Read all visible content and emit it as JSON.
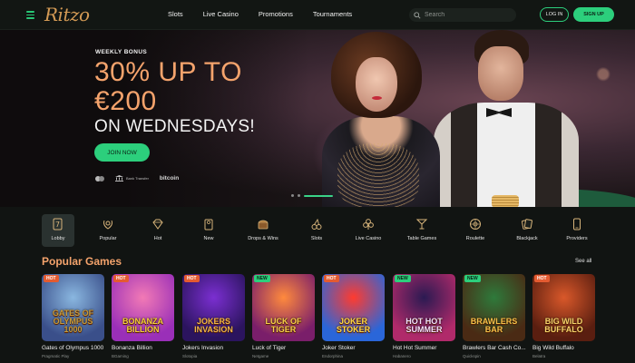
{
  "header": {
    "logo": "Ritzo",
    "nav": [
      "Slots",
      "Live Casino",
      "Promotions",
      "Tournaments"
    ],
    "search_placeholder": "Search",
    "login_label": "LOG IN",
    "signup_label": "SIGN UP"
  },
  "hero": {
    "eyebrow": "WEEKLY BONUS",
    "line1": "30% UP TO",
    "line2": "€200",
    "line3": "ON WEDNESDAYS!",
    "cta": "JOIN NOW",
    "payments": [
      "mastercard-icon",
      "Bank Transfer",
      "bitcoin"
    ],
    "active_slide": 3,
    "slide_count": 3
  },
  "categories": [
    {
      "label": "Lobby",
      "icon": "lobby-icon"
    },
    {
      "label": "Popular",
      "icon": "laurel-icon"
    },
    {
      "label": "Hot",
      "icon": "diamond-icon"
    },
    {
      "label": "New",
      "icon": "door-hanger-icon"
    },
    {
      "label": "Drops & Wins",
      "icon": "treasure-icon"
    },
    {
      "label": "Slots",
      "icon": "cherries-icon"
    },
    {
      "label": "Live Casino",
      "icon": "club-icon"
    },
    {
      "label": "Table Games",
      "icon": "cocktail-icon"
    },
    {
      "label": "Roulette",
      "icon": "roulette-icon"
    },
    {
      "label": "Blackjack",
      "icon": "cards-icon"
    },
    {
      "label": "Providers",
      "icon": "phone-icon"
    }
  ],
  "popular": {
    "title": "Popular Games",
    "see_all": "See all",
    "games": [
      {
        "name": "Gates of Olympus 1000",
        "provider": "Pragmatic Play",
        "art": "GATES OF OLYMPUS 1000",
        "badge": "HOT",
        "colors": [
          "#8ab7e0",
          "#3a4f8a",
          "#c59b3d"
        ]
      },
      {
        "name": "Bonanza Billion",
        "provider": "BGaming",
        "art": "BONANZA BILLION",
        "badge": "HOT",
        "colors": [
          "#f27ab5",
          "#9a2fb8",
          "#f5cf3a"
        ]
      },
      {
        "name": "Jokers Invasion",
        "provider": "Slotopia",
        "art": "JOKERS INVASION",
        "badge": "HOT",
        "colors": [
          "#7b2fd1",
          "#2b145e",
          "#f0b64a"
        ]
      },
      {
        "name": "Luck of Tiger",
        "provider": "Netgame",
        "art": "LUCK OF TIGER",
        "badge": "NEW",
        "colors": [
          "#ff8a3d",
          "#7a1e6a",
          "#f8d04a"
        ]
      },
      {
        "name": "Joker Stoker",
        "provider": "Endorphina",
        "art": "JOKER STOKER",
        "badge": "HOT",
        "colors": [
          "#ff3b2f",
          "#2a66d9",
          "#ffd94a"
        ]
      },
      {
        "name": "Hot Hot Summer",
        "provider": "Habanero",
        "art": "HOT HOT SUMMER",
        "badge": "NEW",
        "colors": [
          "#2b1a52",
          "#b02a6a",
          "#f3e0ff"
        ]
      },
      {
        "name": "Brawlers Bar Cash Co...",
        "provider": "Quickspin",
        "art": "BRAWLERS BAR",
        "badge": "NEW",
        "colors": [
          "#2e7a3b",
          "#4a2a14",
          "#f1c24a"
        ]
      },
      {
        "name": "Big Wild Buffalo",
        "provider": "Belatra",
        "art": "BIG WILD BUFFALO",
        "badge": "HOT",
        "colors": [
          "#d9582a",
          "#5a1e10",
          "#f6d36a"
        ]
      }
    ]
  },
  "colors": {
    "accent": "#2ccf7c",
    "headline": "#f4a36c",
    "background": "#111412"
  }
}
